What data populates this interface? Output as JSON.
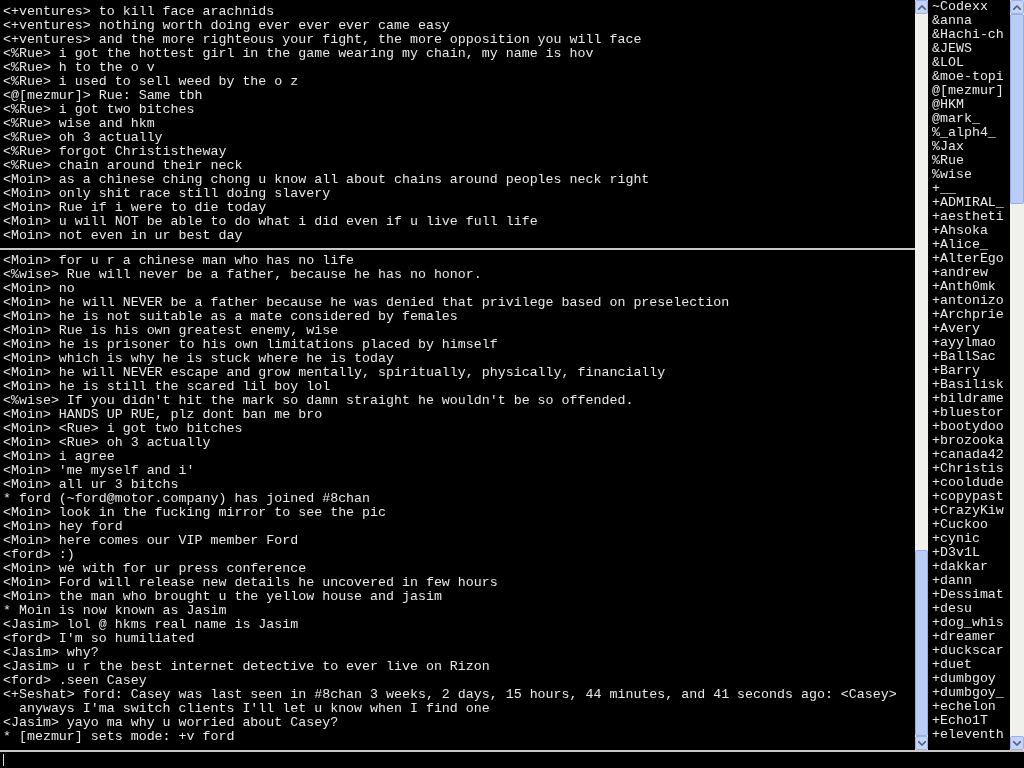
{
  "top_pane": {
    "lines": [
      "<+ventures> to kill face arachnids",
      "<+ventures> nothing worth doing ever ever ever came easy",
      "<+ventures> and the more righteous your fight, the more opposition you will face",
      "<%Rue> i got the hottest girl in the game wearing my chain, my name is hov",
      "<%Rue> h to the o v",
      "<%Rue> i used to sell weed by the o z",
      "<@[mezmur]> Rue: Same tbh",
      "<%Rue> i got two bitches",
      "<%Rue> wise and hkm",
      "<%Rue> oh 3 actually",
      "<%Rue> forgot Christistheway",
      "<%Rue> chain around their neck",
      "<Moin> as a chinese ching chong u know all about chains around peoples neck right",
      "<Moin> only shit race still doing slavery",
      "<Moin> Rue if i were to die today",
      "<Moin> u will NOT be able to do what i did even if u live full life",
      "<Moin> not even in ur best day"
    ]
  },
  "bottom_pane": {
    "lines": [
      "<Moin> for u r a chinese man who has no life",
      "<%wise> Rue will never be a father, because he has no honor.",
      "<Moin> no",
      "<Moin> he will NEVER be a father because he was denied that privilege based on preselection",
      "<Moin> he is not suitable as a mate considered by females",
      "<Moin> Rue is his own greatest enemy, wise",
      "<Moin> he is prisoner to his own limitations placed by himself",
      "<Moin> which is why he is stuck where he is today",
      "<Moin> he will NEVER escape and grow mentally, spiritually, physically, financially",
      "<Moin> he is still the scared lil boy lol",
      "<%wise> If you didn't hit the mark so damn straight he wouldn't be so offended.",
      "<Moin> HANDS UP RUE, plz dont ban me bro",
      "<Moin> <Rue> i got two bitches",
      "<Moin> <Rue> oh 3 actually",
      "<Moin> i agree",
      "<Moin> 'me myself and i'",
      "<Moin> all ur 3 bitchs",
      "* ford (~ford@motor.company) has joined #8chan",
      "<Moin> look in the fucking mirror to see the pic",
      "<Moin> hey ford",
      "<Moin> here comes our VIP member Ford",
      "<ford> :)",
      "<Moin> we with for ur press conference",
      "<Moin> Ford will release new details he uncovered in few hours",
      "<Moin> the man who brought u the yellow house and jasim",
      "* Moin is now known as Jasim",
      "<Jasim> lol @ hkms real name is Jasim",
      "<ford> I'm so humiliated",
      "<Jasim> why?",
      "<Jasim> u r the best internet detective to ever live on Rizon",
      "<ford> .seen Casey",
      "<+Seshat> ford: Casey was last seen in #8chan 3 weeks, 2 days, 15 hours, 44 minutes, and 41 seconds ago: <Casey>",
      "  anyways I'ma switch clients I'll let u know when I find one",
      "<Jasim> yayo ma why u worried about Casey?",
      "* [mezmur] sets mode: +v ford"
    ]
  },
  "nicklist": [
    "~Codexx",
    "&anna",
    "&Hachi-ch",
    "&JEWS",
    "&LOL",
    "&moe-topi",
    "@[mezmur]",
    "@HKM",
    "@mark_",
    "%_alph4_",
    "%Jax",
    "%Rue",
    "%wise",
    "+__",
    "+ADMIRAL_",
    "+aestheti",
    "+Ahsoka",
    "+Alice_",
    "+AlterEgo",
    "+andrew",
    "+Anth0mk",
    "+antonizo",
    "+Archprie",
    "+Avery",
    "+ayylmao",
    "+BallSac",
    "+Barry",
    "+Basilisk",
    "+bildrame",
    "+bluestor",
    "+bootydoo",
    "+brozooka",
    "+canada42",
    "+Christis",
    "+cooldude",
    "+copypast",
    "+CrazyKiw",
    "+Cuckoo",
    "+cynic",
    "+D3v1L",
    "+dakkar",
    "+dann",
    "+Dessimat",
    "+desu",
    "+dog_whis",
    "+dreamer",
    "+duckscar",
    "+duet",
    "+dumbgoy",
    "+dumbgoy_",
    "+echelon",
    "+Echo1T",
    "+eleventh"
  ]
}
